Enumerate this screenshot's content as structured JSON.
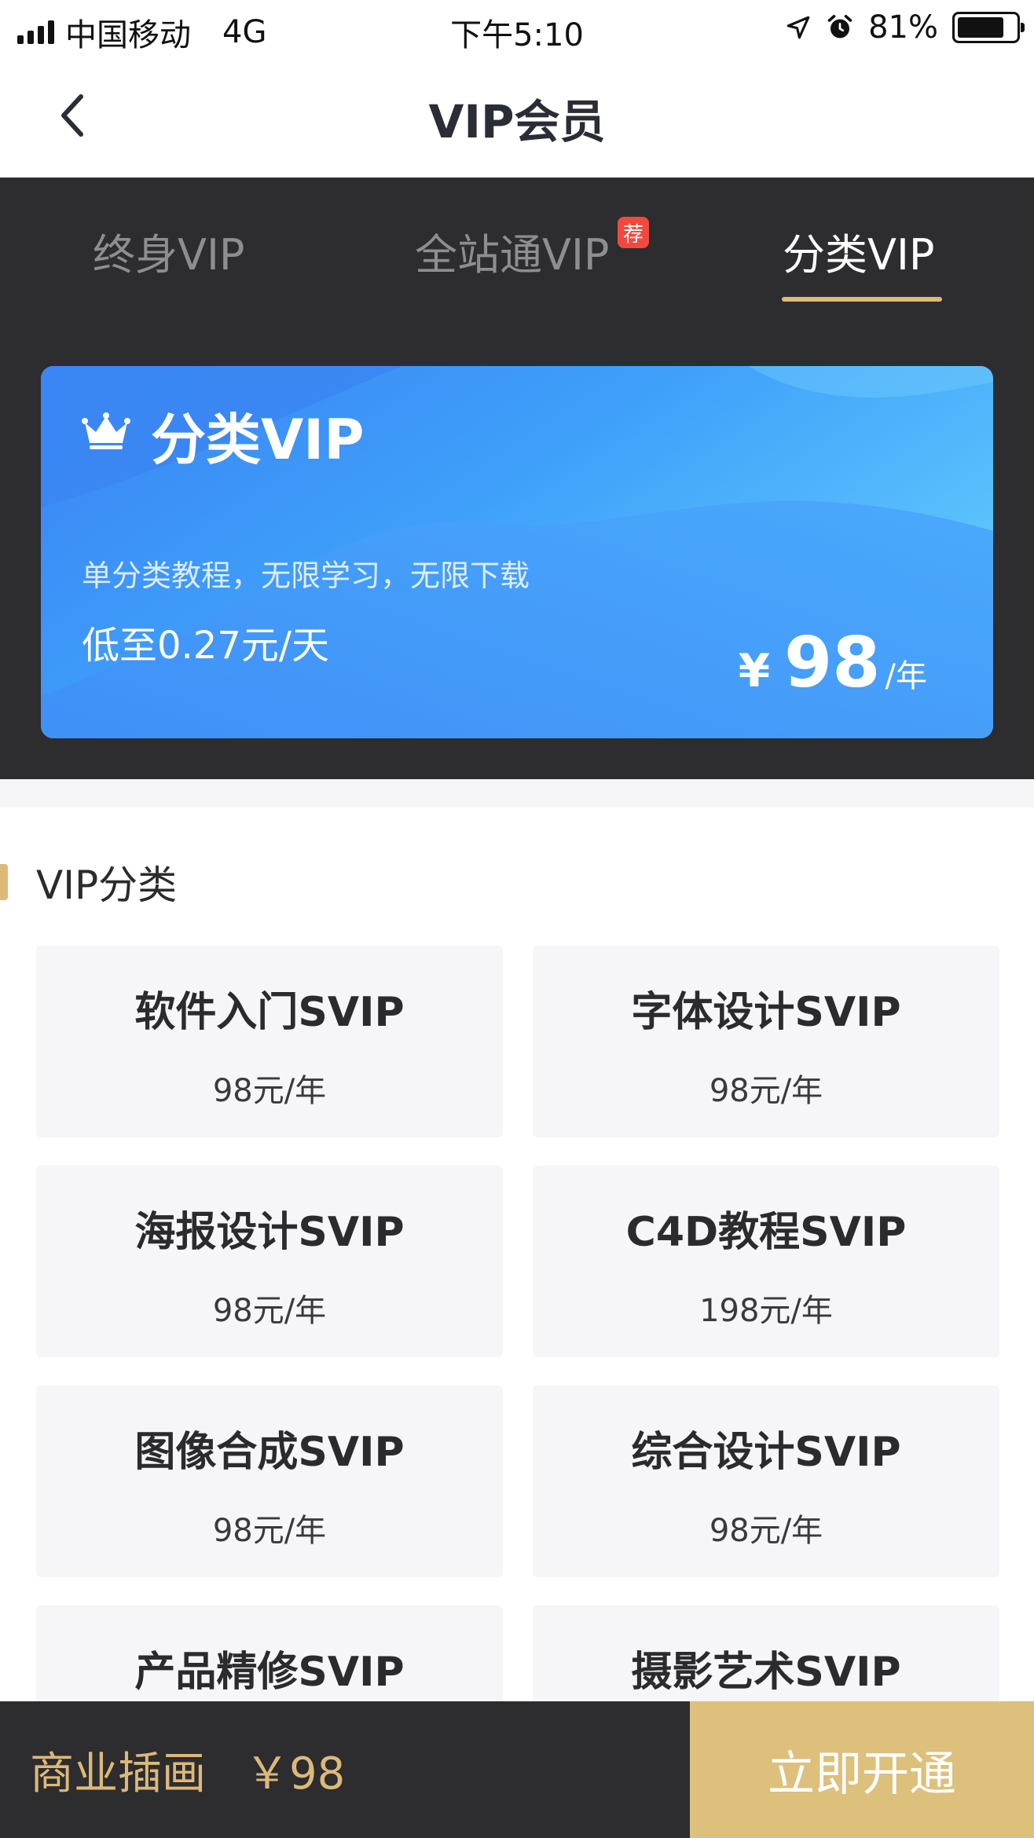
{
  "status_bar": {
    "carrier": "中国移动",
    "network": "4G",
    "time": "下午5:10",
    "battery_percent": "81%",
    "battery_level": 0.81,
    "icons": [
      "signal-icon",
      "location-icon",
      "alarm-icon",
      "battery-icon"
    ]
  },
  "nav": {
    "title": "VIP会员",
    "back_icon": "chevron-left-icon"
  },
  "tabs": [
    {
      "label": "终身VIP",
      "active": false
    },
    {
      "label": "全站通VIP",
      "active": false,
      "badge": "荐"
    },
    {
      "label": "分类VIP",
      "active": true
    }
  ],
  "card": {
    "icon": "crown-icon",
    "title": "分类VIP",
    "description": "单分类教程，无限学习，无限下载",
    "daily_price": "低至0.27元/天",
    "currency": "¥",
    "price": "98",
    "unit": "/年"
  },
  "section": {
    "title": "VIP分类"
  },
  "categories": [
    {
      "name": "软件入门SVIP",
      "price": "98元/年"
    },
    {
      "name": "字体设计SVIP",
      "price": "98元/年"
    },
    {
      "name": "海报设计SVIP",
      "price": "98元/年"
    },
    {
      "name": "C4D教程SVIP",
      "price": "198元/年"
    },
    {
      "name": "图像合成SVIP",
      "price": "98元/年"
    },
    {
      "name": "综合设计SVIP",
      "price": "98元/年"
    },
    {
      "name": "产品精修SVIP",
      "price": ""
    },
    {
      "name": "摄影艺术SVIP",
      "price": ""
    }
  ],
  "bottom_bar": {
    "selected_category": "商业插画",
    "selected_price": "￥98",
    "cta_label": "立即开通"
  },
  "colors": {
    "accent_gold": "#dcb97a",
    "dark_bg": "#2d2c2f",
    "card_blue": "#3d96f9",
    "badge_red": "#f04a3e",
    "cta_gold": "#dcc07c"
  }
}
